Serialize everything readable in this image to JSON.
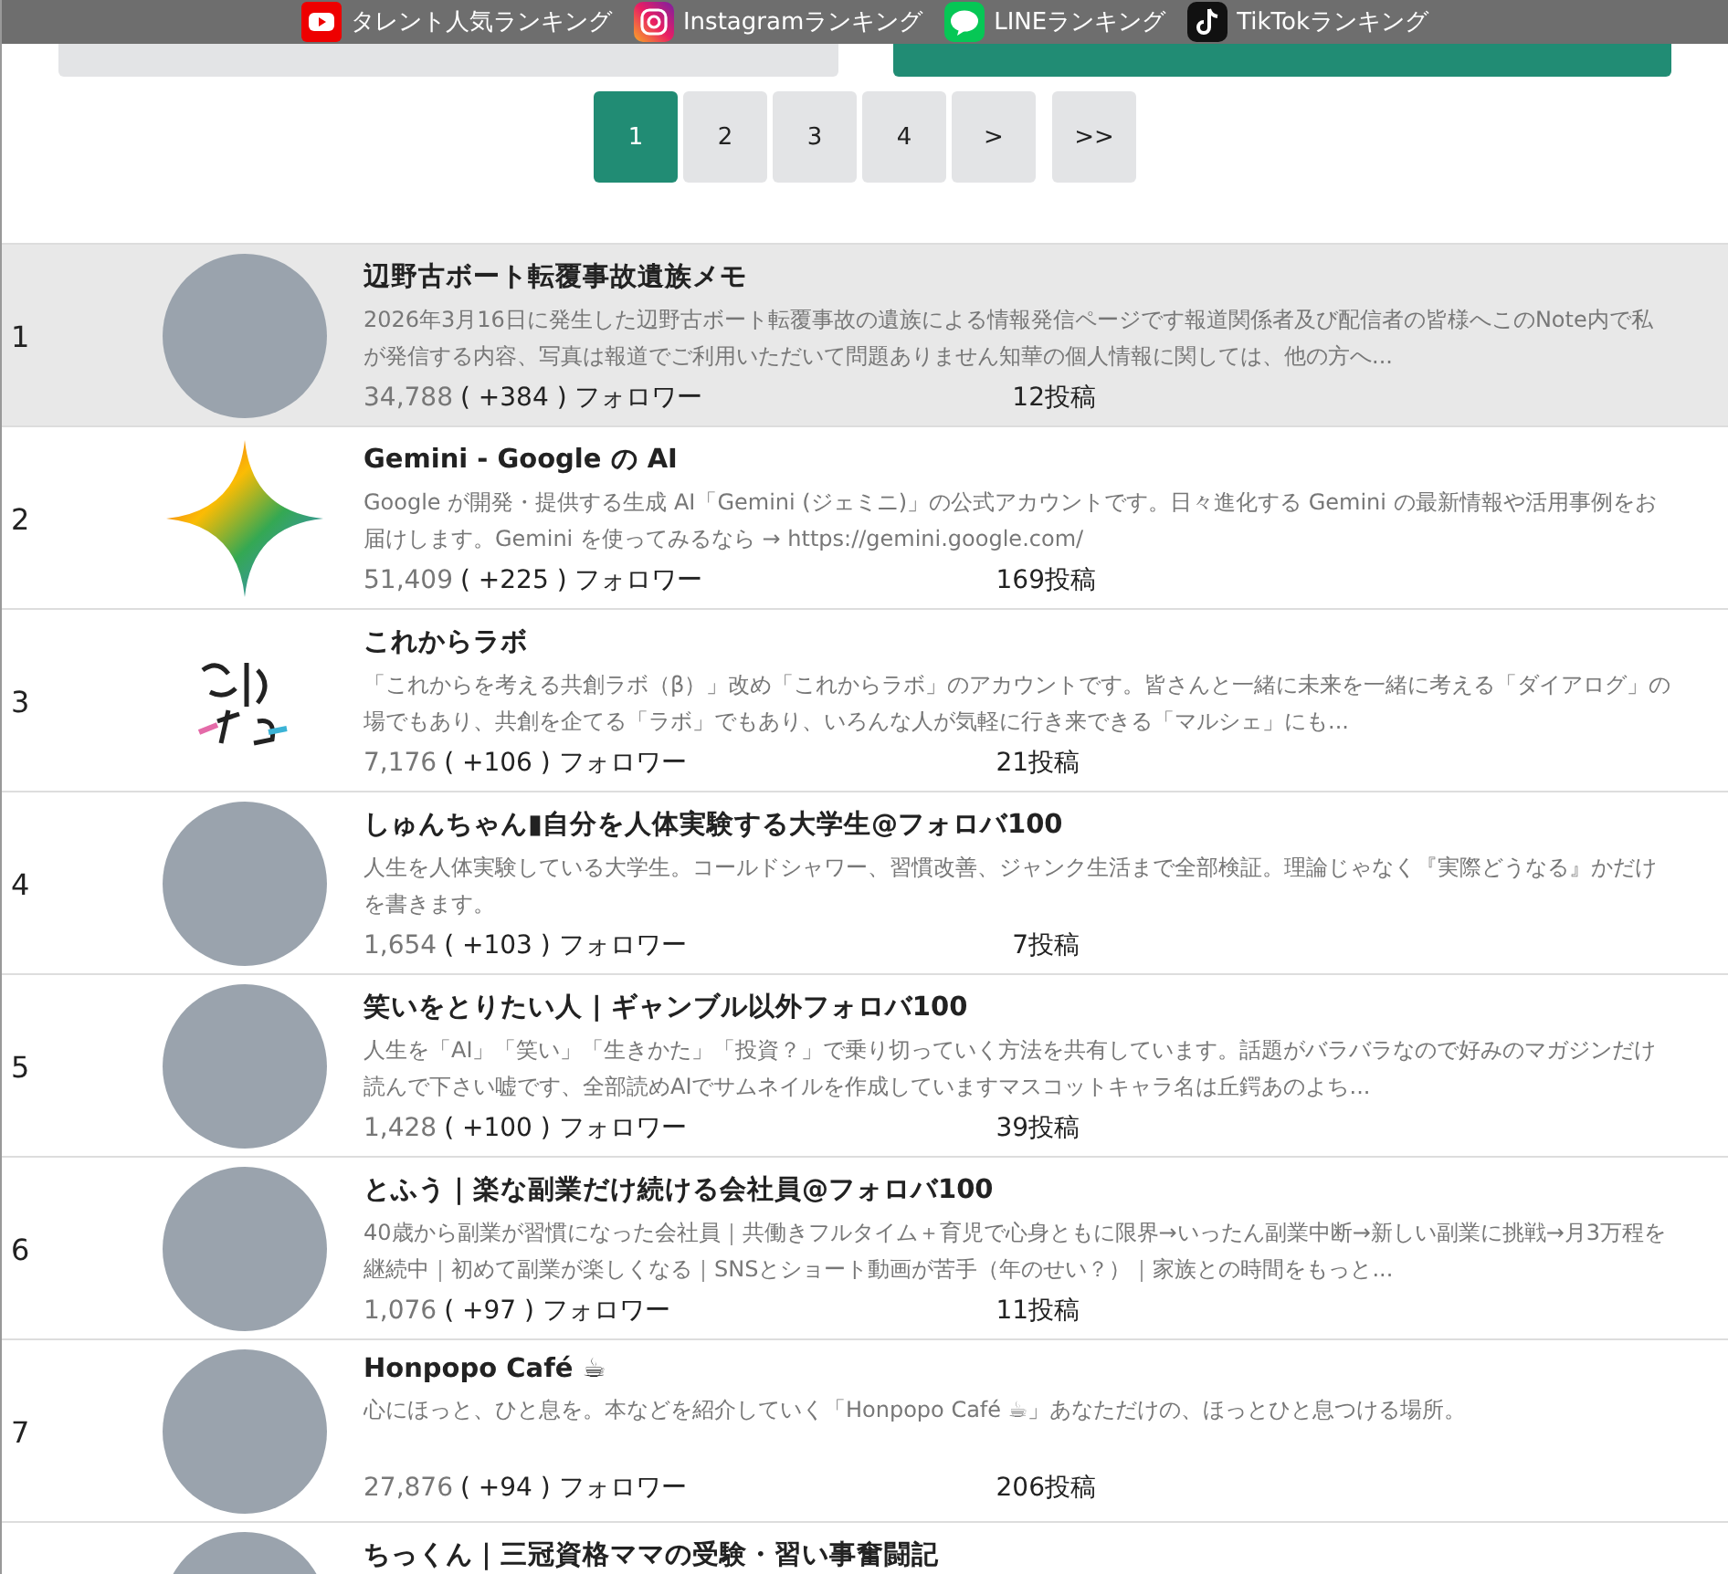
{
  "top_bar": {
    "links": [
      {
        "label": "タレント人気ランキング",
        "kind": "youtube"
      },
      {
        "label": "Instagramランキング",
        "kind": "instagram"
      },
      {
        "label": "LINEランキング",
        "kind": "line"
      },
      {
        "label": "TikTokランキング",
        "kind": "tiktok"
      }
    ]
  },
  "sort_tabs": [
    {
      "selected": false
    },
    {
      "selected": true
    }
  ],
  "pagination": [
    {
      "label": "1",
      "selected": true
    },
    {
      "label": "2",
      "selected": false
    },
    {
      "label": "3",
      "selected": false
    },
    {
      "label": "4",
      "selected": false
    },
    {
      "label": ">",
      "selected": false
    },
    {
      "label": ">>",
      "selected": false
    }
  ],
  "ranking": [
    {
      "rank": "1",
      "selected": true,
      "kind": "photo",
      "name": "辺野古ボート転覆事故遺族メモ",
      "description": "2026年3月16日に発生した辺野古ボート転覆事故の遺族による情報発信ページです報道関係者及び配信者の皆様へこのNote内で私が発信する内容、写真は報道でご利用いただいて問題ありません知華の個人情報に関しては、他の方へ...",
      "followers": "34,788",
      "delta": "( +384 ) フォロワー",
      "posts": "12投稿"
    },
    {
      "rank": "2",
      "selected": false,
      "kind": "star",
      "name": "Gemini - Google の AI",
      "description": "Google が開発・提供する生成 AI「Gemini (ジェミニ)」の公式アカウントです。日々進化する Gemini の最新情報や活用事例をお届けします。Gemini を使ってみるなら → https://gemini.google.com/",
      "followers": "51,409",
      "delta": "( +225 ) フォロワー",
      "posts": "169投稿"
    },
    {
      "rank": "3",
      "selected": false,
      "kind": "logo",
      "name": "これからラボ",
      "description": "「これからを考える共創ラボ（β）」改め「これからラボ」のアカウントです。皆さんと一緒に未来を一緒に考える「ダイアログ」の場でもあり、共創を企てる「ラボ」でもあり、いろんな人が気軽に行き来できる「マルシェ」にも...",
      "followers": "7,176",
      "delta": "( +106 ) フォロワー",
      "posts": "21投稿"
    },
    {
      "rank": "4",
      "selected": false,
      "kind": "photo",
      "name": "しゅんちゃん▮自分を人体実験する大学生@フォロバ100",
      "description": "人生を人体実験している大学生。コールドシャワー、習慣改善、ジャンク生活まで全部検証。理論じゃなく『実際どうなる』かだけを書きます。",
      "followers": "1,654",
      "delta": "( +103 ) フォロワー",
      "posts": "7投稿"
    },
    {
      "rank": "5",
      "selected": false,
      "kind": "photo",
      "name": "笑いをとりたい人 | ギャンブル以外フォロバ100",
      "description": "人生を「AI」「笑い」「生きかた」「投資？」で乗り切っていく方法を共有しています。話題がバラバラなので好みのマガジンだけ読んで下さい嘘です、全部読めAIでサムネイルを作成していますマスコットキャラ名は丘鍔あのよち...",
      "followers": "1,428",
      "delta": "( +100 ) フォロワー",
      "posts": "39投稿"
    },
    {
      "rank": "6",
      "selected": false,
      "kind": "photo",
      "name": "とふう｜楽な副業だけ続ける会社員@フォロバ100",
      "description": "40歳から副業が習慣になった会社員｜共働きフルタイム＋育児で心身ともに限界→いったん副業中断→新しい副業に挑戦→月3万程を継続中｜初めて副業が楽しくなる｜SNSとショート動画が苦手（年のせい？）｜家族との時間をもっと...",
      "followers": "1,076",
      "delta": "( +97 ) フォロワー",
      "posts": "11投稿"
    },
    {
      "rank": "7",
      "selected": false,
      "kind": "photo",
      "name": "Honpopo Café ☕",
      "description": "心にほっと、ひと息を。本などを紹介していく「Honpopo Café ☕」あなただけの、ほっとひと息つける場所。",
      "followers": "27,876",
      "delta": "( +94 ) フォロワー",
      "posts": "206投稿"
    },
    {
      "selected": false,
      "kind": "photo",
      "name": "ちっくん｜三冠資格ママの受験・習い事奮闘記"
    }
  ]
}
